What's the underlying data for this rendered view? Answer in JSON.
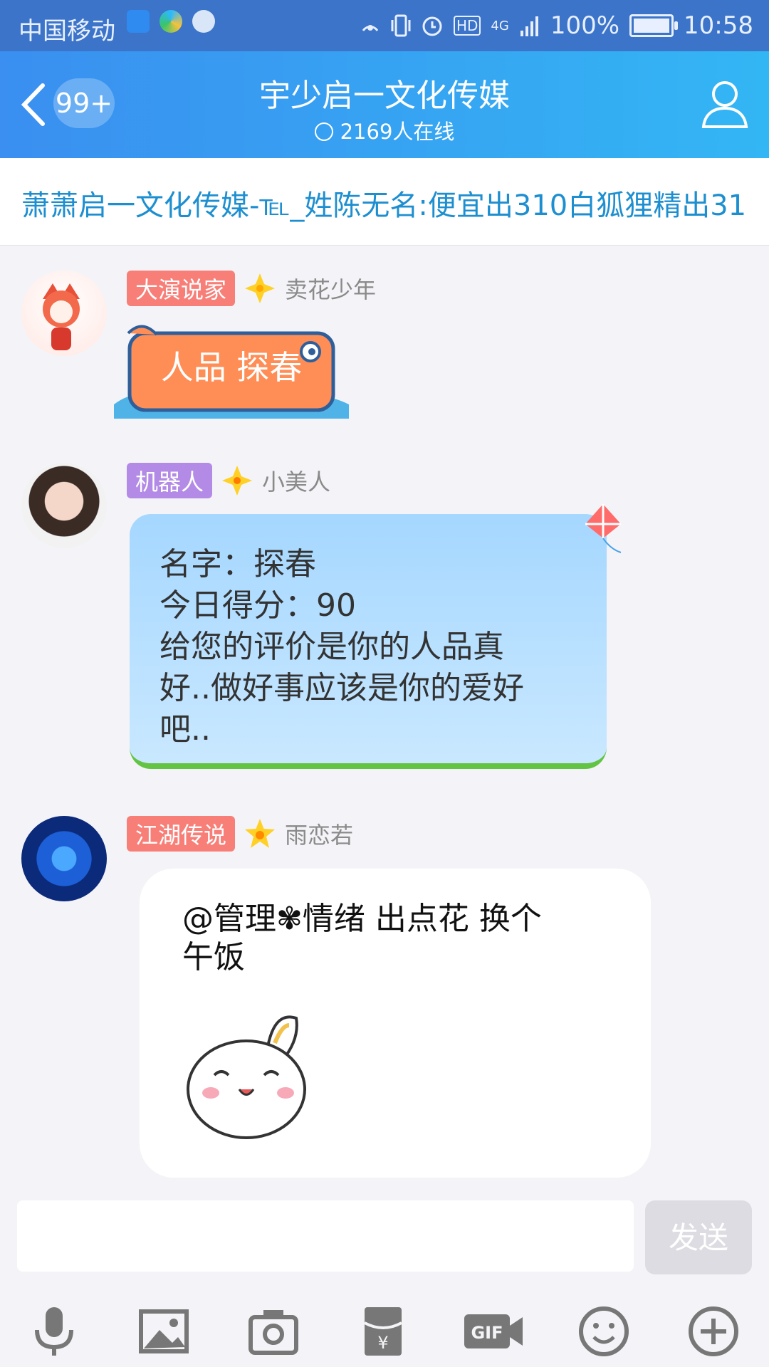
{
  "status_bar": {
    "carrier": "中国移动",
    "battery": "100%",
    "time": "10:58",
    "network": "4G",
    "hd": "HD"
  },
  "header": {
    "back_badge": "99+",
    "title": "宇少启一文化传媒",
    "online": "2169人在线"
  },
  "ticker": {
    "text": "萧萧启一文化传媒-℡_姓陈无名:便宜出310白狐狸精出31"
  },
  "messages": [
    {
      "tag": "大演说家",
      "tag_color": "#f77f78",
      "nickname": "卖花少年",
      "sticker_text": "人品 探春"
    },
    {
      "tag": "机器人",
      "tag_color": "#b38be6",
      "nickname": "小美人",
      "lines": [
        "名字：探春",
        "今日得分：90",
        "给您的评价是你的人品真",
        "好..做好事应该是你的爱好",
        "吧.."
      ]
    },
    {
      "tag": "江湖传说",
      "tag_color": "#f77f78",
      "nickname": "雨恋若",
      "lines": [
        "@管理✾情绪 出点花 换个",
        "午饭"
      ]
    }
  ],
  "input": {
    "send_label": "发送"
  },
  "toolbar": [
    "mic-icon",
    "image-icon",
    "camera-icon",
    "red-packet-icon",
    "gif-icon",
    "emoji-icon",
    "plus-icon"
  ]
}
